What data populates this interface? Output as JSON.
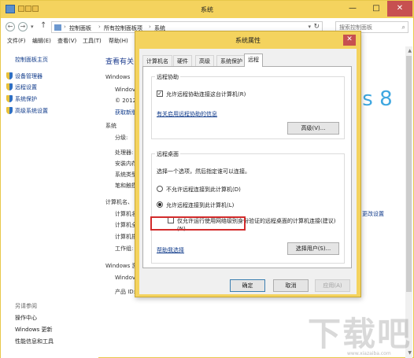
{
  "window": {
    "title": "系统",
    "min": "—",
    "max": "□",
    "close": "✕"
  },
  "address": {
    "crumbs": [
      "控制面板",
      "所有控制面板项",
      "系统"
    ],
    "separator": "›",
    "search_placeholder": "搜索控制面板"
  },
  "menu": [
    "文件(F)",
    "编辑(E)",
    "查看(V)",
    "工具(T)",
    "帮助(H)"
  ],
  "left": {
    "home": "控制面板主页",
    "links": [
      "设备管理器",
      "远程设置",
      "系统保护",
      "高级系统设置"
    ],
    "see_also_title": "另请参阅",
    "see_also": [
      "操作中心",
      "Windows 更新",
      "性能信息和工具"
    ]
  },
  "content": {
    "title": "查看有关",
    "edition_label": "Windows",
    "edition_fragment1": "Windov",
    "edition_fragment2": "© 2012",
    "more_link": "获取新版",
    "system_label": "系统",
    "rating": "分级:",
    "processor": "处理器:",
    "ram": "安装内存",
    "system_type": "系统类型",
    "pen": "笔和触摸",
    "computer_section": "计算机名、",
    "comp_name": "计算机名",
    "full_name": "计算机全",
    "comp_desc": "计算机描",
    "workgroup": "工作组:",
    "activation": "Windows 激",
    "activation_frag": "Windov",
    "product_id": "产品 ID:",
    "change_settings": "更改设置",
    "win8_logo": "ws 8"
  },
  "dialog": {
    "title": "系统属性",
    "close": "✕",
    "tabs": [
      "计算机名",
      "硬件",
      "高级",
      "系统保护",
      "远程"
    ],
    "active_tab": "远程",
    "assistance": {
      "group_label": "远程协助",
      "checkbox_label": "允许远程协助连接这台计算机(R)",
      "checked": true,
      "link": "有关启用远程协助的信息",
      "advanced_button": "高级(V)..."
    },
    "desktop": {
      "group_label": "远程桌面",
      "instruction": "选择一个选项，然后指定谁可以连接。",
      "option_deny": "不允许远程连接到此计算机(D)",
      "option_allow": "允许远程连接到此计算机(L)",
      "selected": "allow",
      "nla_label_line1": "仅允许运行使用网络级别身份验证的远程桌面的计算机连接(建议)",
      "nla_label_line2": "(N)",
      "nla_checked": false,
      "help_link": "帮助我选择",
      "select_users_button": "选择用户(S)..."
    },
    "buttons": {
      "ok": "确定",
      "cancel": "取消",
      "apply": "应用(A)"
    }
  },
  "watermark": {
    "text": "下载吧",
    "sub": "www.xiazaiba.com"
  },
  "colors": {
    "title_bar": "#f4d35e",
    "link": "#0f3a8a",
    "highlight": "#d22c2c",
    "close_button": "#c75050"
  }
}
